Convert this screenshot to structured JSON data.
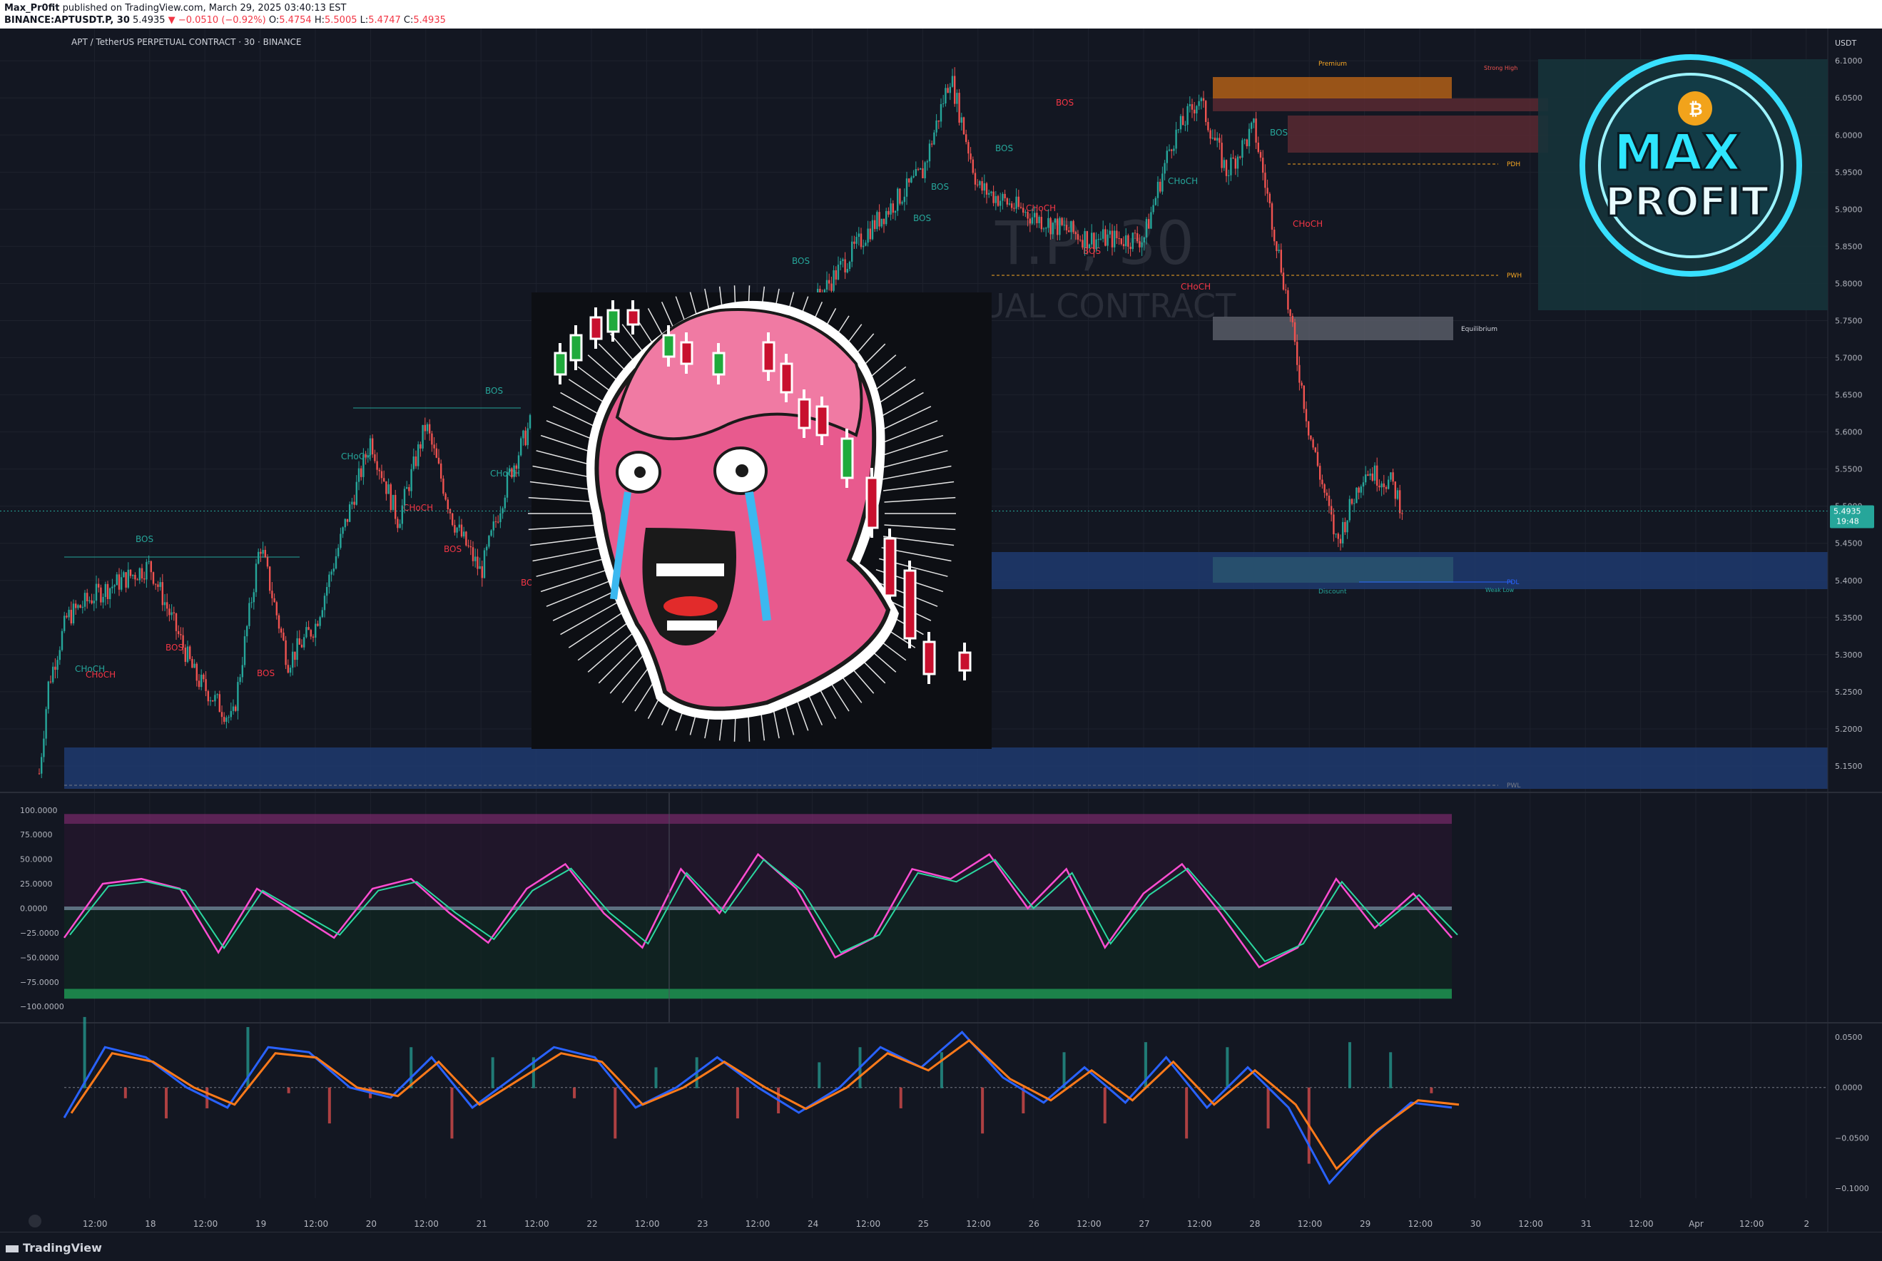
{
  "header": {
    "publisher_line": "Max_Pr0fit published on TradingView.com, March 29, 2025 03:40:13 EST",
    "publisher": "Max_Pr0fit",
    "published_text": " published on TradingView.com, March 29, 2025 03:40:13 EST",
    "symbol_line": "BINANCE:APTUSDT.P, 30",
    "last": "5.4935",
    "change": "−0.0510 (−0.92%)",
    "open": "5.4754",
    "high": "5.5005",
    "low": "5.4747",
    "close": "5.4935",
    "o_label": "O:",
    "h_label": "H:",
    "l_label": "L:",
    "c_label": "C:"
  },
  "pane_title": "APT / TetherUS PERPETUAL CONTRACT · 30 · BINANCE",
  "watermark": {
    "line1": "T.P, 30",
    "line2": "UAL CONTRACT"
  },
  "currency": "USDT",
  "price_badge": {
    "value": "5.4935",
    "timer": "19:48"
  },
  "logo": {
    "line1": "MAX",
    "line2": "PROFIT"
  },
  "zones": {
    "premium": "Premium",
    "strong_high": "Strong High",
    "pdh": "PDH",
    "pwh": "PWH",
    "equilibrium": "Equilibrium",
    "pdl": "PDL",
    "discount": "Discount",
    "weak_low": "Weak Low",
    "pwl": "PWL"
  },
  "structure_labels": [
    {
      "t": "BOS",
      "c": "#26a69a"
    },
    {
      "t": "BOS",
      "c": "#f23645"
    },
    {
      "t": "BOS",
      "c": "#f23645"
    },
    {
      "t": "BOS",
      "c": "#26a69a"
    },
    {
      "t": "CHoCH",
      "c": "#26a69a"
    },
    {
      "t": "CHoCH",
      "c": "#f23645"
    },
    {
      "t": "BOS",
      "c": "#f23645"
    },
    {
      "t": "CHoCH",
      "c": "#26a69a"
    },
    {
      "t": "BOS",
      "c": "#26a69a"
    },
    {
      "t": "BOS",
      "c": "#26a69a"
    },
    {
      "t": "BOS",
      "c": "#26a69a"
    },
    {
      "t": "BOS",
      "c": "#26a69a"
    },
    {
      "t": "CHoCH",
      "c": "#f23645"
    },
    {
      "t": "BOS",
      "c": "#f23645"
    },
    {
      "t": "CHoCH",
      "c": "#26a69a"
    },
    {
      "t": "CHoCH",
      "c": "#f23645"
    },
    {
      "t": "BOS",
      "c": "#26a69a"
    },
    {
      "t": "CHoCH",
      "c": "#f23645"
    },
    {
      "t": "CHoCH",
      "c": "#26a69a"
    },
    {
      "t": "CHoCH",
      "c": "#f23645"
    },
    {
      "t": "BOS",
      "c": "#f23645"
    },
    {
      "t": "BOS",
      "c": "#f23645"
    }
  ],
  "colors": {
    "up": "#26a69a",
    "down": "#ef5350",
    "background": "#131722",
    "grid": "#1e222d",
    "k_line": "#ff4dd2",
    "d_line": "#2bd8a0",
    "macd": "#2962ff",
    "signal": "#ff7a1a"
  },
  "footer": {
    "brand": "TradingView"
  },
  "chart_data": [
    {
      "type": "candlestick",
      "title": "APT / TetherUS PERPETUAL CONTRACT · 30 · BINANCE",
      "ylabel": "USDT",
      "ylim": [
        5.125,
        6.105
      ],
      "y_ticks": [
        "6.1000",
        "6.0500",
        "6.0000",
        "5.9500",
        "5.9000",
        "5.8500",
        "5.8000",
        "5.7500",
        "5.7000",
        "5.6500",
        "5.6000",
        "5.5500",
        "5.5000",
        "5.4500",
        "5.4000",
        "5.3500",
        "5.3000",
        "5.2500",
        "5.2000",
        "5.1500"
      ],
      "x_ticks": [
        "12:00",
        "18",
        "12:00",
        "19",
        "12:00",
        "20",
        "12:00",
        "21",
        "12:00",
        "22",
        "12:00",
        "23",
        "12:00",
        "24",
        "12:00",
        "25",
        "12:00",
        "26",
        "12:00",
        "27",
        "12:00",
        "28",
        "12:00",
        "29",
        "12:00",
        "30",
        "12:00",
        "31",
        "12:00",
        "Apr",
        "12:00",
        "2"
      ],
      "x_range": [
        "17 Mar 00:00",
        "2 Apr 12:00"
      ],
      "price_path": [
        {
          "t": "17 00:00",
          "p": 5.14
        },
        {
          "t": "17 02:00",
          "p": 5.26
        },
        {
          "t": "17 06:00",
          "p": 5.35
        },
        {
          "t": "17 12:00",
          "p": 5.38
        },
        {
          "t": "18 00:00",
          "p": 5.42
        },
        {
          "t": "18 10:00",
          "p": 5.27
        },
        {
          "t": "18 18:00",
          "p": 5.21
        },
        {
          "t": "19 00:00",
          "p": 5.45
        },
        {
          "t": "19 06:00",
          "p": 5.29
        },
        {
          "t": "19 12:00",
          "p": 5.34
        },
        {
          "t": "20 00:00",
          "p": 5.59
        },
        {
          "t": "20 06:00",
          "p": 5.48
        },
        {
          "t": "20 12:00",
          "p": 5.61
        },
        {
          "t": "20 18:00",
          "p": 5.48
        },
        {
          "t": "21 00:00",
          "p": 5.41
        },
        {
          "t": "21 06:00",
          "p": 5.54
        },
        {
          "t": "21 12:00",
          "p": 5.63
        },
        {
          "t": "22 00:00",
          "p": 5.47
        },
        {
          "t": "22 12:00",
          "p": 5.52
        },
        {
          "t": "23 00:00",
          "p": 5.61
        },
        {
          "t": "23 12:00",
          "p": 5.66
        },
        {
          "t": "24 00:00",
          "p": 5.77
        },
        {
          "t": "24 12:00",
          "p": 5.87
        },
        {
          "t": "25 00:00",
          "p": 5.95
        },
        {
          "t": "25 06:00",
          "p": 6.08
        },
        {
          "t": "25 12:00",
          "p": 5.93
        },
        {
          "t": "26 00:00",
          "p": 5.89
        },
        {
          "t": "26 12:00",
          "p": 5.86
        },
        {
          "t": "27 00:00",
          "p": 5.86
        },
        {
          "t": "27 06:00",
          "p": 5.99
        },
        {
          "t": "27 12:00",
          "p": 6.05
        },
        {
          "t": "27 18:00",
          "p": 5.95
        },
        {
          "t": "28 00:00",
          "p": 6.01
        },
        {
          "t": "28 06:00",
          "p": 5.82
        },
        {
          "t": "28 12:00",
          "p": 5.6
        },
        {
          "t": "28 18:00",
          "p": 5.45
        },
        {
          "t": "29 00:00",
          "p": 5.55
        },
        {
          "t": "29 06:00",
          "p": 5.53
        },
        {
          "t": "29 08:30",
          "p": 5.4935
        }
      ],
      "last_price": 5.4935
    },
    {
      "type": "line",
      "title": "",
      "ylim": [
        -110,
        110
      ],
      "y_ticks": [
        "100.0000",
        "75.0000",
        "50.0000",
        "25.0000",
        "0.0000",
        "−25.0000",
        "−50.0000",
        "−75.0000",
        "−100.0000"
      ],
      "levels": [
        {
          "v": 100,
          "band": [
            86,
            96
          ]
        },
        {
          "v": 0
        },
        {
          "v": -80,
          "band": [
            -92,
            -82
          ]
        }
      ],
      "series": [
        {
          "name": "",
          "values": [
            -30,
            25,
            30,
            20,
            -45,
            20,
            -5,
            -30,
            20,
            30,
            -5,
            -35,
            20,
            45,
            -5,
            -40,
            40,
            -5,
            55,
            20,
            -50,
            -30,
            40,
            30,
            55,
            0,
            40,
            -40,
            15,
            45,
            -5,
            -60,
            -40,
            30,
            -20,
            15,
            -30
          ]
        }
      ]
    },
    {
      "type": "line",
      "title": "",
      "ylim": [
        -0.11,
        0.06
      ],
      "y_ticks": [
        "0.0500",
        "0.0000",
        "−0.0500",
        "−0.1000"
      ],
      "series": [
        {
          "name": "",
          "values": [
            -0.03,
            0.04,
            0.03,
            0.0,
            -0.02,
            0.04,
            0.035,
            0.0,
            -0.01,
            0.03,
            -0.02,
            0.01,
            0.04,
            0.03,
            -0.02,
            0.0,
            0.03,
            0.0,
            -0.025,
            0.0,
            0.04,
            0.02,
            0.055,
            0.01,
            -0.015,
            0.02,
            -0.015,
            0.03,
            -0.02,
            0.02,
            -0.02,
            -0.095,
            -0.05,
            -0.015,
            -0.02
          ]
        }
      ]
    }
  ]
}
